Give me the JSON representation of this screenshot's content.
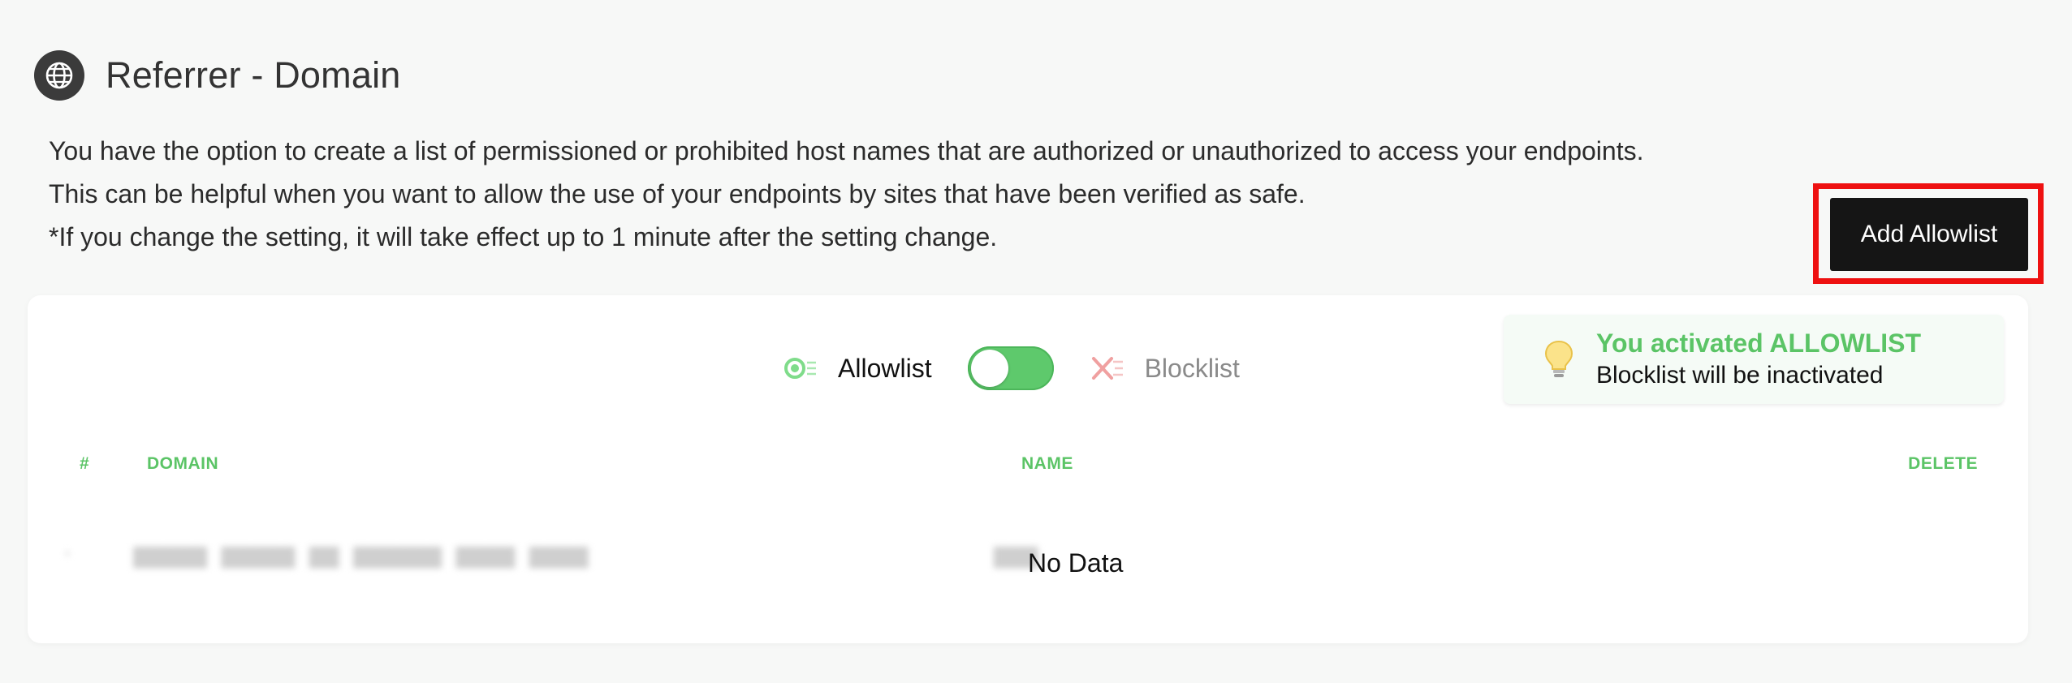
{
  "header": {
    "icon": "globe-icon",
    "title": "Referrer - Domain"
  },
  "description": {
    "line1": "You have the option to create a list of permissioned or prohibited host names that are authorized or unauthorized to access your endpoints.",
    "line2": "This can be helpful when you want to allow the use of your endpoints by sites that have been verified as safe.",
    "line3": "*If you change the setting, it will take effect up to 1 minute after the setting change."
  },
  "actions": {
    "add_label": "Add Allowlist"
  },
  "toggle": {
    "allowlist_label": "Allowlist",
    "blocklist_label": "Blocklist",
    "state": "allowlist",
    "allowlist_icon": "allowlist-icon",
    "blocklist_icon": "blocklist-icon"
  },
  "info": {
    "icon": "lightbulb-icon",
    "title": "You activated ALLOWLIST",
    "subtitle": "Blocklist will be inactivated"
  },
  "table": {
    "columns": [
      "#",
      "DOMAIN",
      "NAME",
      "DELETE"
    ],
    "empty_text": "No Data"
  },
  "colors": {
    "accent_green": "#5bc466",
    "button_dark": "#151515",
    "highlight_red": "#ee1111"
  }
}
